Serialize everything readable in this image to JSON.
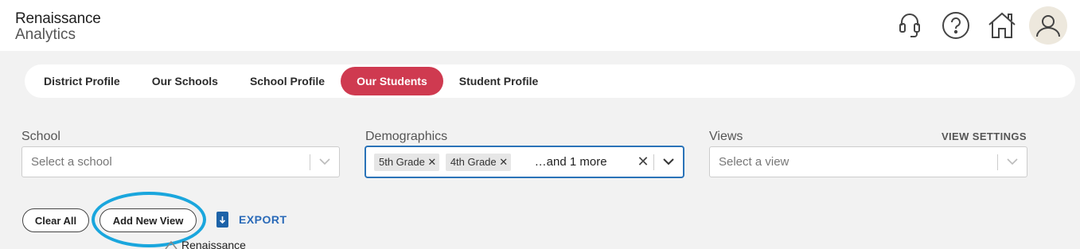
{
  "brand": {
    "line1": "Renaissance",
    "line2": "Analytics"
  },
  "header_icons": [
    "headset-icon",
    "help-icon",
    "home-icon",
    "user-icon"
  ],
  "tabs": [
    {
      "label": "District Profile",
      "active": false
    },
    {
      "label": "Our Schools",
      "active": false
    },
    {
      "label": "School Profile",
      "active": false
    },
    {
      "label": "Our Students",
      "active": true
    },
    {
      "label": "Student Profile",
      "active": false
    }
  ],
  "filters": {
    "school": {
      "label": "School",
      "placeholder": "Select a school"
    },
    "demographics": {
      "label": "Demographics",
      "chips": [
        "5th Grade",
        "4th Grade"
      ],
      "more_text": "…and 1 more"
    },
    "views": {
      "label": "Views",
      "placeholder": "Select a view",
      "settings_label": "VIEW SETTINGS"
    }
  },
  "actions": {
    "clear_all": "Clear All",
    "add_new_view": "Add New View",
    "export": "EXPORT"
  },
  "footer_logo_text": "Renaissance",
  "colors": {
    "active_tab": "#cf3a50",
    "focus_border": "#2a73b8",
    "highlight_ring": "#1aa6dd",
    "export_blue": "#2a6ab8"
  }
}
